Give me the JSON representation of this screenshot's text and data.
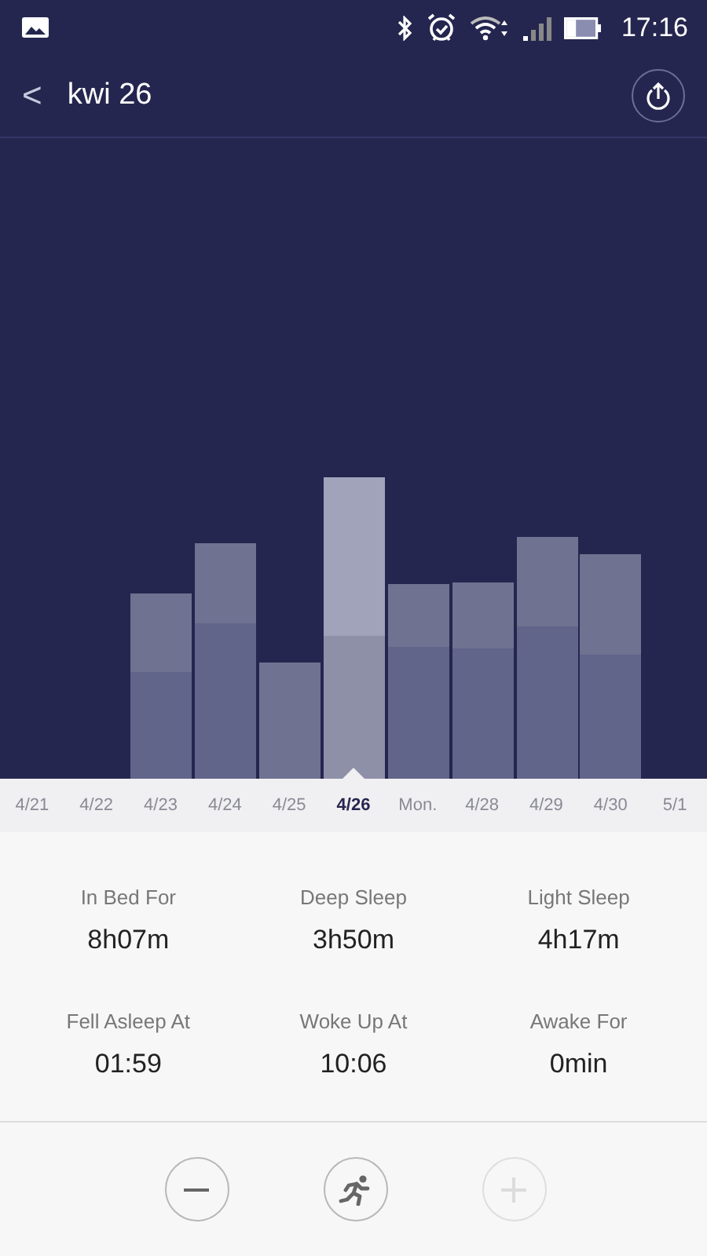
{
  "status_bar": {
    "time": "17:16"
  },
  "header": {
    "title": "kwi 26",
    "back_glyph": "<"
  },
  "days": [
    {
      "label": "4/21",
      "selected": false
    },
    {
      "label": "4/22",
      "selected": false
    },
    {
      "label": "4/23",
      "selected": false
    },
    {
      "label": "4/24",
      "selected": false
    },
    {
      "label": "4/25",
      "selected": false
    },
    {
      "label": "4/26",
      "selected": true
    },
    {
      "label": "Mon.",
      "selected": false
    },
    {
      "label": "4/28",
      "selected": false
    },
    {
      "label": "4/29",
      "selected": false
    },
    {
      "label": "4/30",
      "selected": false
    },
    {
      "label": "5/1",
      "selected": false
    }
  ],
  "stats": [
    {
      "label": "In Bed For",
      "value": "8h07m"
    },
    {
      "label": "Deep Sleep",
      "value": "3h50m"
    },
    {
      "label": "Light Sleep",
      "value": "4h17m"
    },
    {
      "label": "Fell Asleep At",
      "value": "01:59"
    },
    {
      "label": "Woke Up At",
      "value": "10:06"
    },
    {
      "label": "Awake For",
      "value": "0min"
    }
  ],
  "actions": [
    {
      "kind": "minus",
      "disabled": false
    },
    {
      "kind": "run",
      "disabled": false
    },
    {
      "kind": "plus",
      "disabled": true
    }
  ]
}
